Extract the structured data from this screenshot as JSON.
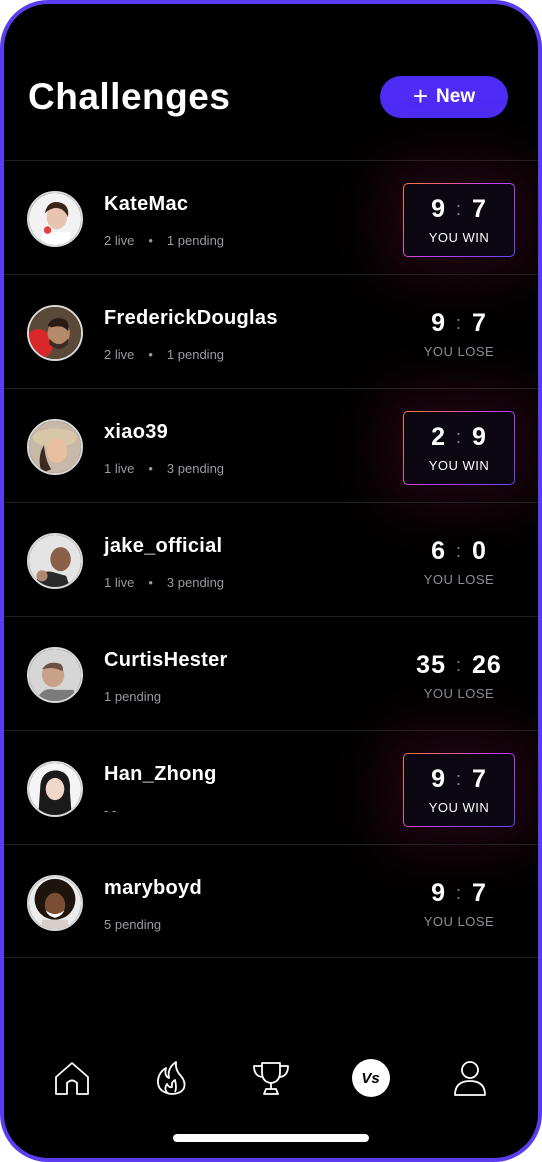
{
  "header": {
    "title": "Challenges",
    "new_button": {
      "icon": "plus-icon",
      "label": "New"
    }
  },
  "challenges": [
    {
      "name": "KateMac",
      "live": "2 live",
      "sep": "•",
      "pending": "1 pending",
      "score_left": "9",
      "score_right": "7",
      "result": "YOU WIN",
      "status": "win"
    },
    {
      "name": "FrederickDouglas",
      "live": "2 live",
      "sep": "•",
      "pending": "1 pending",
      "score_left": "9",
      "score_right": "7",
      "result": "YOU LOSE",
      "status": "lose"
    },
    {
      "name": "xiao39",
      "live": "1 live",
      "sep": "•",
      "pending": "3 pending",
      "score_left": "2",
      "score_right": "9",
      "result": "YOU WIN",
      "status": "win"
    },
    {
      "name": "jake_official",
      "live": "1 live",
      "sep": "•",
      "pending": "3 pending",
      "score_left": "6",
      "score_right": "0",
      "result": "YOU LOSE",
      "status": "lose"
    },
    {
      "name": "CurtisHester",
      "live": "",
      "sep": "",
      "pending": "1 pending",
      "score_left": "35",
      "score_right": "26",
      "result": "YOU LOSE",
      "status": "lose"
    },
    {
      "name": "Han_Zhong",
      "live": "- -",
      "sep": "",
      "pending": "",
      "score_left": "9",
      "score_right": "7",
      "result": "YOU WIN",
      "status": "win"
    },
    {
      "name": "maryboyd",
      "live": "",
      "sep": "",
      "pending": "5 pending",
      "score_left": "9",
      "score_right": "7",
      "result": "YOU LOSE",
      "status": "lose"
    }
  ],
  "score_separator": ":",
  "tabbar": {
    "items": [
      {
        "icon": "home-icon"
      },
      {
        "icon": "flame-icon"
      },
      {
        "icon": "trophy-icon"
      },
      {
        "icon": "versus-icon",
        "label": "Vs",
        "active": true
      },
      {
        "icon": "profile-icon"
      }
    ]
  },
  "colors": {
    "accent": "#4f2cf5",
    "frame": "#5b3cf0",
    "background": "#000000",
    "win_gradient_start": "#ff7a3d",
    "win_gradient_mid": "#c03cff",
    "win_gradient_end": "#5e47ff",
    "muted_text": "#9a9aa0"
  }
}
